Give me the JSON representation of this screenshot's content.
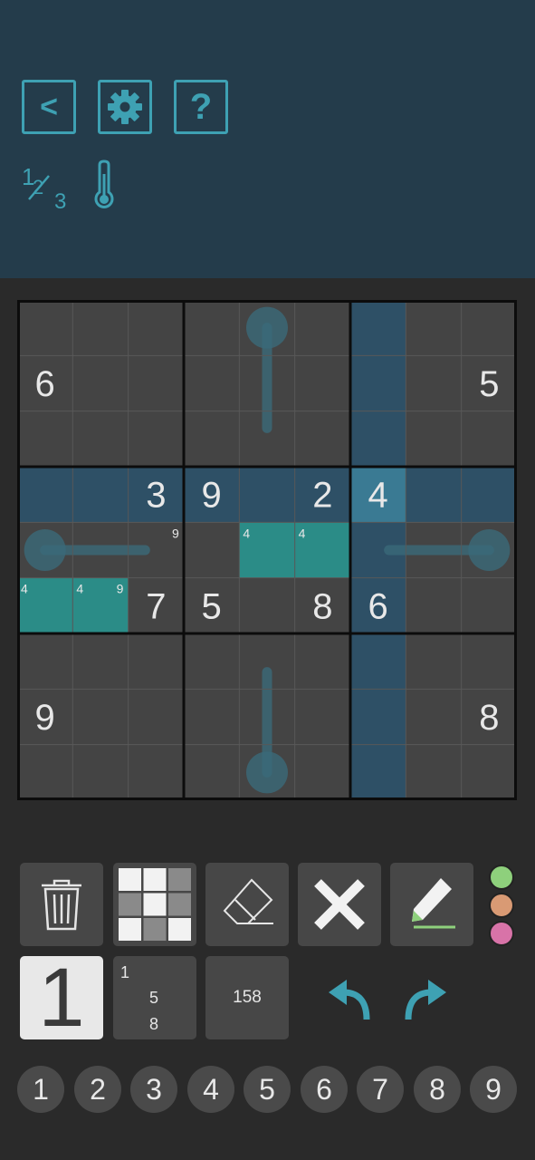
{
  "header": {
    "back_label": "<",
    "help_label": "?",
    "colors": {
      "bg": "#243c4b",
      "accent": "#3ea1b3"
    },
    "icons": [
      "gear-icon",
      "number-mode-icon",
      "thermometer-icon"
    ]
  },
  "grid": {
    "cells": [
      {
        "r": 1,
        "c": 0,
        "v": "6"
      },
      {
        "r": 1,
        "c": 8,
        "v": "5"
      },
      {
        "r": 3,
        "c": 2,
        "v": "3"
      },
      {
        "r": 3,
        "c": 3,
        "v": "9"
      },
      {
        "r": 3,
        "c": 5,
        "v": "2"
      },
      {
        "r": 3,
        "c": 6,
        "v": "4"
      },
      {
        "r": 5,
        "c": 2,
        "v": "7"
      },
      {
        "r": 5,
        "c": 3,
        "v": "5"
      },
      {
        "r": 5,
        "c": 5,
        "v": "8"
      },
      {
        "r": 5,
        "c": 6,
        "v": "6"
      },
      {
        "r": 7,
        "c": 0,
        "v": "9"
      },
      {
        "r": 7,
        "c": 8,
        "v": "8"
      }
    ],
    "pencil": [
      {
        "r": 4,
        "c": 2,
        "p": "tr",
        "v": "9"
      },
      {
        "r": 4,
        "c": 4,
        "p": "tl",
        "v": "4"
      },
      {
        "r": 4,
        "c": 5,
        "p": "tl",
        "v": "4"
      },
      {
        "r": 5,
        "c": 0,
        "p": "tl",
        "v": "4"
      },
      {
        "r": 5,
        "c": 1,
        "p": "tl",
        "v": "4"
      },
      {
        "r": 5,
        "c": 1,
        "p": "tr",
        "v": "9"
      }
    ],
    "highlight_row": 3,
    "highlight_col": 6,
    "selected": {
      "r": 3,
      "c": 6
    },
    "teal_cells": [
      [
        4,
        4
      ],
      [
        4,
        5
      ],
      [
        5,
        0
      ],
      [
        5,
        1
      ]
    ],
    "thermometers": [
      {
        "bulb": [
          0,
          4
        ],
        "cells": [
          [
            0,
            4
          ],
          [
            1,
            4
          ],
          [
            2,
            4
          ]
        ]
      },
      {
        "bulb": [
          4,
          0
        ],
        "cells": [
          [
            4,
            0
          ],
          [
            4,
            1
          ],
          [
            4,
            2
          ]
        ]
      },
      {
        "bulb": [
          4,
          8
        ],
        "cells": [
          [
            4,
            8
          ],
          [
            4,
            7
          ],
          [
            4,
            6
          ]
        ]
      },
      {
        "bulb": [
          8,
          4
        ],
        "cells": [
          [
            8,
            4
          ],
          [
            7,
            4
          ],
          [
            6,
            4
          ]
        ]
      }
    ]
  },
  "tools": {
    "items": [
      "trash-icon",
      "grid-icon",
      "eraser-icon",
      "close-icon",
      "pencil-icon"
    ],
    "color_palette": [
      "#8ed07c",
      "#d99a74",
      "#d873a8"
    ]
  },
  "entry_modes": {
    "normal_label": "1",
    "corner_labels": [
      "1",
      "5",
      "8"
    ],
    "center_label": "158"
  },
  "digits": [
    "1",
    "2",
    "3",
    "4",
    "5",
    "6",
    "7",
    "8",
    "9"
  ]
}
